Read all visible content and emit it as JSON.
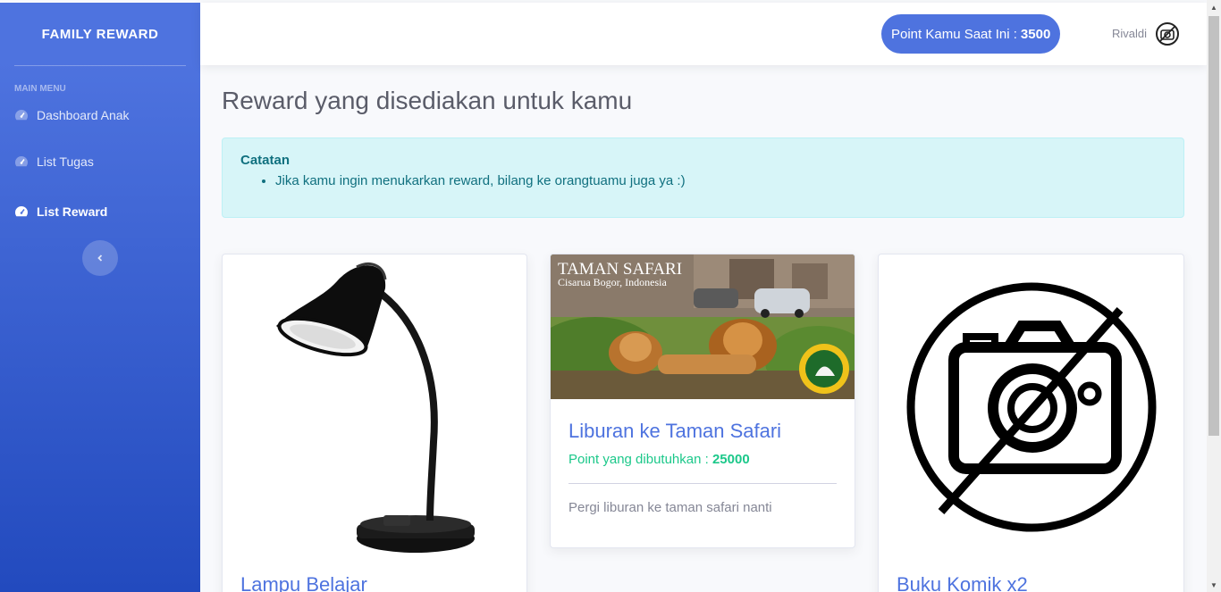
{
  "sidebar": {
    "brand": "FAMILY REWARD",
    "heading": "MAIN MENU",
    "items": [
      {
        "label": "Dashboard Anak"
      },
      {
        "label": "List Tugas"
      },
      {
        "label": "List Reward"
      }
    ]
  },
  "topbar": {
    "points_label": "Point Kamu Saat Ini :",
    "points_value": "3500",
    "user_name": "Rivaldi"
  },
  "page": {
    "title": "Reward yang disediakan untuk kamu"
  },
  "alert": {
    "title": "Catatan",
    "note": "Jika kamu ingin menukarkan reward, bilang ke orangtuamu juga ya :)"
  },
  "cards": [
    {
      "title": "Lampu Belajar"
    },
    {
      "title": "Liburan ke Taman Safari",
      "points_label": "Point yang dibutuhkan :",
      "points_value": "25000",
      "description": "Pergi liburan ke taman safari nanti",
      "image_text_1": "TAMAN SAFARI",
      "image_text_2": "Cisarua Bogor, Indonesia"
    },
    {
      "title": "Buku Komik x2"
    }
  ],
  "colors": {
    "primary": "#4e73df",
    "success": "#1cc88a",
    "alert_bg": "#d7f5f8"
  }
}
